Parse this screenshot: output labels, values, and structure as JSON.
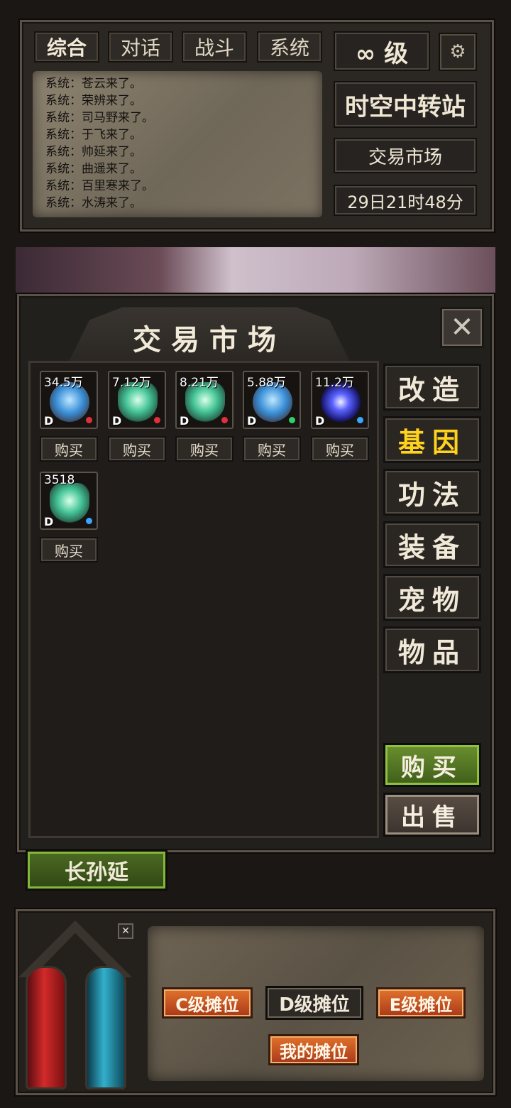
{
  "chat": {
    "tabs": [
      "综合",
      "对话",
      "战斗",
      "系统"
    ],
    "lines": [
      "系统：苍云来了。",
      "系统：荣辨来了。",
      "系统：司马野来了。",
      "系统：于飞来了。",
      "系统：帅延来了。",
      "系统：曲遥来了。",
      "系统：百里寒来了。",
      "系统：水涛来了。"
    ]
  },
  "status": {
    "level": "∞ 级",
    "location": "时空中转站",
    "market": "交易市场",
    "time": "29日21时48分"
  },
  "dialog": {
    "title": "交易市场",
    "close_icon": "✕",
    "items": [
      {
        "price": "34.5万",
        "grade": "D",
        "icon": "cube-icon",
        "dot_color": "#e0303a"
      },
      {
        "price": "7.12万",
        "grade": "D",
        "icon": "crystal-icon",
        "dot_color": "#e0303a"
      },
      {
        "price": "8.21万",
        "grade": "D",
        "icon": "crystal-icon",
        "dot_color": "#e0303a"
      },
      {
        "price": "5.88万",
        "grade": "D",
        "icon": "cube-icon",
        "dot_color": "#2fd16b"
      },
      {
        "price": "11.2万",
        "grade": "D",
        "icon": "vortex-icon",
        "dot_color": "#3aa6ff"
      },
      {
        "price": "3518",
        "grade": "D",
        "icon": "crystal-icon",
        "dot_color": "#3aa6ff"
      }
    ],
    "buy_label": "购买",
    "categories": [
      "改造",
      "基因",
      "功法",
      "装备",
      "宠物",
      "物品"
    ],
    "active_category": "基因",
    "actions": {
      "buy": "购买",
      "sell": "出售"
    }
  },
  "player": {
    "name": "长孙延"
  },
  "stalls": {
    "c": "C级摊位",
    "d": "D级摊位",
    "e": "E级摊位",
    "mine": "我的摊位"
  },
  "colors": {
    "active_category": "#ffd21e",
    "stall_orange": "#c9501f",
    "buy_green": "#5a8a2a"
  }
}
